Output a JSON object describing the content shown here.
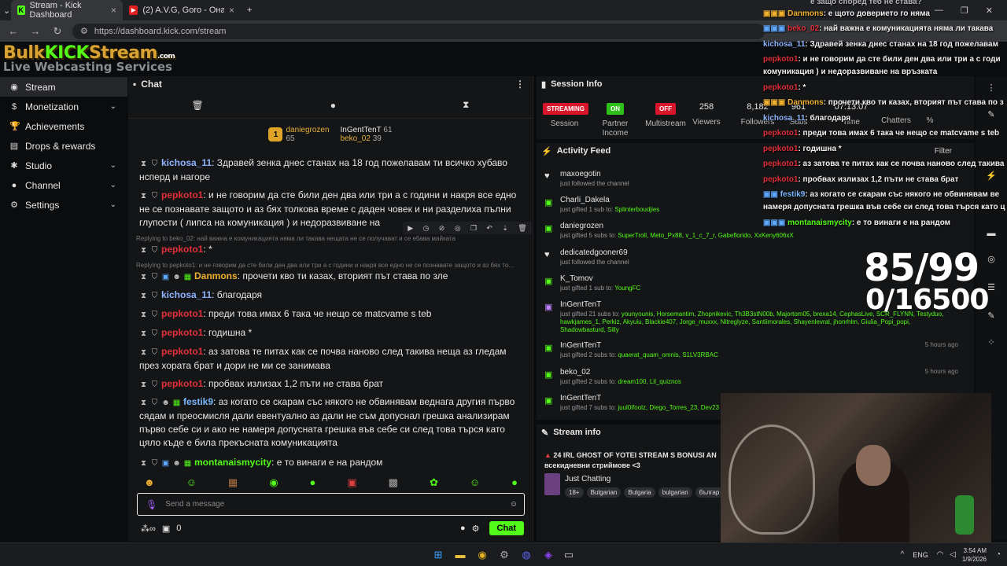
{
  "browser": {
    "tabs": [
      {
        "label": "Stream - Kick Dashboard",
        "favicon": "K"
      },
      {
        "label": "(2) A.V.G, Goro - Она близко (",
        "favicon": "▶"
      }
    ],
    "url": "https://dashboard.kick.com/stream"
  },
  "logo": {
    "brand_a": "Bulk",
    "brand_kick": "KICK",
    "brand_b": "Stream",
    "domain": ".com",
    "tagline": "Live Webcasting Services"
  },
  "sidebar": {
    "items": [
      {
        "label": "Stream",
        "icon": "broadcast-icon"
      },
      {
        "label": "Monetization",
        "icon": "dollar-icon"
      },
      {
        "label": "Achievements",
        "icon": "trophy-icon"
      },
      {
        "label": "Drops & rewards",
        "icon": "gift-icon"
      },
      {
        "label": "Studio",
        "icon": "gear-icon"
      },
      {
        "label": "Channel",
        "icon": "user-icon"
      },
      {
        "label": "Settings",
        "icon": "settings-icon"
      }
    ]
  },
  "chat": {
    "title": "Chat",
    "leaderboard": [
      {
        "name": "daniegrozen",
        "count": "65",
        "rank": "1"
      },
      {
        "name": "InGentTenT",
        "count": "61"
      },
      {
        "name": "beko_02",
        "count": "39"
      }
    ],
    "messages": [
      {
        "user": "kichosa_11",
        "color": "#8fb4ff",
        "text": ": Здравей зенка днес станах на 18 год пожелавам ти всичко хубаво нсперд и нагоре"
      },
      {
        "user": "pepkoto1",
        "color": "#e0303a",
        "text": ": и не говорим да сте били ден два или три а с години и накря все едно не се познавате защото и аз бях толкова време с даден човек и ни разделиха пълни глупости ( липса на комуникация ) и недоразвиване на"
      },
      {
        "reply": "Replying to beko_02: най важна е комуникацията няма ли такава нещата не се получават и се ебава майката"
      },
      {
        "user": "pepkoto1",
        "color": "#e0303a",
        "text": ": *"
      },
      {
        "reply": "Replying to pepkoto1: и не говорим да сте били ден два или три а с години и накря все едно не се познавате защото и аз бях то..."
      },
      {
        "user": "Danmons",
        "color": "#f0b030",
        "text": ": прочети кво ти казах, вторият път става по зле"
      },
      {
        "user": "kichosa_11",
        "color": "#8fb4ff",
        "text": ": благодаря"
      },
      {
        "user": "pepkoto1",
        "color": "#e0303a",
        "text": ": преди това имах 6 така че нещо се matcvame s teb"
      },
      {
        "user": "pepkoto1",
        "color": "#e0303a",
        "text": ": годишна *"
      },
      {
        "user": "pepkoto1",
        "color": "#e0303a",
        "text": ": аз затова те питах как се почва наново след такива неща аз гледам през хората брат и дори не ми се занимава"
      },
      {
        "user": "pepkoto1",
        "color": "#e0303a",
        "text": ": пробвах излизах 1,2 пъти не става брат"
      },
      {
        "user": "festik9",
        "color": "#7ab8ff",
        "text": ": аз когато се скарам със някого не обвинявам веднага другия първо сядам и преосмисля дали евентуално аз дали не съм допуснал грешка анализирам първо себе си и ако не намеря допусната грешка във себе си след това търся като цяло къде е била прекъсната комуникацията"
      },
      {
        "user": "montanaismycity",
        "color": "#53fc18",
        "text": ": е то винаги е на рандом"
      }
    ],
    "input_placeholder": "Send a message",
    "points": "0",
    "send_label": "Chat"
  },
  "session": {
    "title": "Session Info",
    "streaming_label": "STREAMING",
    "session_label": "Session",
    "partner_pill": "ON",
    "partner_label": "Partner Income",
    "multi_pill": "OFF",
    "multi_label": "Multistream",
    "viewers": "258",
    "viewers_label": "Viewers",
    "followers": "8,182",
    "followers_label": "Followers",
    "subs": "961",
    "subs_label": "Subs",
    "time": "07:13:07",
    "time_label": "Time",
    "chatters_label": "Chatters",
    "percent_label": "%"
  },
  "activity": {
    "title": "Activity Feed",
    "filter_label": "Filter",
    "items": [
      {
        "name": "maxoegotin",
        "icon": "heart-icon",
        "desc": "just followed the channel",
        "time": ""
      },
      {
        "name": "Charli_Dakela",
        "icon": "gift-icon",
        "desc": "just gifted 1 sub to: ",
        "recipients": "Splinterboudjies",
        "time": ""
      },
      {
        "name": "daniegrozen",
        "icon": "gift-icon",
        "desc": "just gifted 5 subs to: ",
        "recipients": "SuperTroll, Meto_Px88, v_1_c_7_r, Gabeflorido, XxKeny606xX",
        "time": ""
      },
      {
        "name": "dedicatedgooner69",
        "icon": "heart-icon",
        "desc": "just followed the channel",
        "time": ""
      },
      {
        "name": "K_Tomov",
        "icon": "gift-icon",
        "desc": "just gifted 1 sub to: ",
        "recipients": "YoungFC",
        "time": ""
      },
      {
        "name": "InGentTenT",
        "icon": "gift-icon",
        "desc": "just gifted 21 subs to: ",
        "recipients": "younyounis, Horsemantim, Zhopnikevic, Th3B3stN00b, Majortom05, brexa14, CephasLive, SCR_FLYNN, Testyduo, hawkjames_1, Perkiz, Akyuiu, Blackie407, Jorge_muxxx, Nitreglyze, Santiimorales, Shayenlevral, jhonrhlm, Giulia_Popi_popi, Shadowbasturd, Silly",
        "time": ""
      },
      {
        "name": "InGentTenT",
        "icon": "gift-icon",
        "desc": "just gifted 2 subs to: ",
        "recipients": "quaerat_quam_omnis, S1LV3RBAC",
        "time": "5 hours ago"
      },
      {
        "name": "beko_02",
        "icon": "gift-icon",
        "desc": "just gifted 2 subs to: ",
        "recipients": "dream100, Lil_quiznos",
        "time": "5 hours ago"
      },
      {
        "name": "InGentTenT",
        "icon": "gift-icon",
        "desc": "just gifted 7 subs to: ",
        "recipients": "juul0ifoolz, Diego_Torres_23, Dev23",
        "time": ""
      }
    ]
  },
  "streaminfo": {
    "title": "Stream info",
    "stream_title": "24 IRL GHOST OF YOTEI STREAM S BONUSI AN",
    "stream_subtitle": "всекидневни стриймове <3",
    "category": "Just Chatting",
    "tags": [
      "18+",
      "Bulgarian",
      "Bulgaria",
      "bulgarian",
      "българ"
    ]
  },
  "overlay": {
    "lines": [
      {
        "user": "Danmons",
        "color": "#f0b030",
        "text": ": е щото доверието го няма"
      },
      {
        "user": "beko_02",
        "color": "#e0303a",
        "text": ": най важна е комуникацията няма ли такава"
      },
      {
        "user": "kichosa_11",
        "color": "#8fb4ff",
        "text": ": Здравей зенка днес станах на 18 год пожелавам"
      },
      {
        "user": "pepkoto1",
        "color": "#e0303a",
        "text": ": и не говорим да сте били ден два или три а с годи"
      },
      {
        "user": "",
        "color": "#e6e6e6",
        "text": "комуникация ) и недоразвиване на връзката"
      },
      {
        "user": "pepkoto1",
        "color": "#e0303a",
        "text": ": *"
      },
      {
        "user": "Danmons",
        "color": "#f0b030",
        "text": ": прочети кво ти казах, вторият път става по з"
      },
      {
        "user": "kichosa_11",
        "color": "#8fb4ff",
        "text": ": благодаря"
      },
      {
        "user": "pepkoto1",
        "color": "#e0303a",
        "text": ": преди това имах 6 така че нещо се matcvame s teb"
      },
      {
        "user": "pepkoto1",
        "color": "#e0303a",
        "text": ": годишна *"
      },
      {
        "user": "pepkoto1",
        "color": "#e0303a",
        "text": ": аз затова те питах как се почва наново след такива"
      },
      {
        "user": "pepkoto1",
        "color": "#e0303a",
        "text": ": пробвах излизах 1,2 пъти не става брат"
      },
      {
        "user": "festik9",
        "color": "#7ab8ff",
        "text": ": аз когато се скарам със някого не обвинявам ве"
      },
      {
        "user": "",
        "color": "#e6e6e6",
        "text": "намеря допусната грешка във себе си след това търся като ц"
      },
      {
        "user": "montanaismycity",
        "color": "#53fc18",
        "text": ": е то винаги е на рандом"
      }
    ],
    "counter_line1": "85/99",
    "counter_line2": "0/16500",
    "top_fragment": "е защо според теб не става?"
  },
  "taskbar": {
    "lang": "ENG",
    "time": "3:54 AM",
    "date": "1/9/2026"
  },
  "colors": {
    "accent": "#53fc18",
    "bg": "#0b0c0e",
    "panel": "#141517",
    "gold": "#e0a426"
  }
}
